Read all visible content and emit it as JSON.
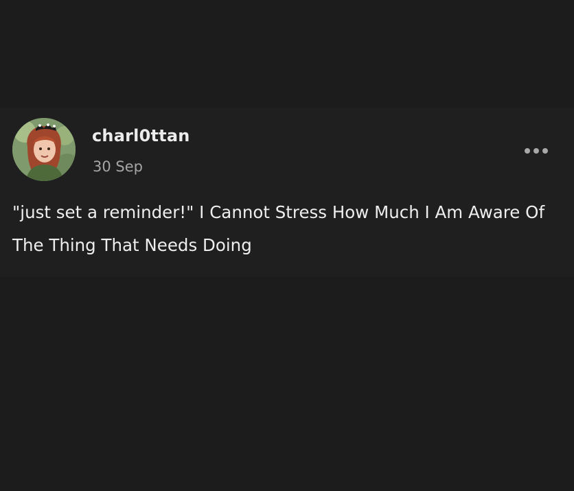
{
  "post": {
    "username": "charl0ttan",
    "timestamp": "30 Sep",
    "text": "\"just set a reminder!\" I Cannot Stress How Much I Am Aware Of The Thing That Needs Doing",
    "avatar_icon": "avatar-illustration-icon",
    "more_icon": "more-options-icon"
  },
  "colors": {
    "page_background": "#1c1c1c",
    "card_background": "#1f1f1f",
    "primary_text": "#eeeeee",
    "secondary_text": "#a6a6a6"
  }
}
